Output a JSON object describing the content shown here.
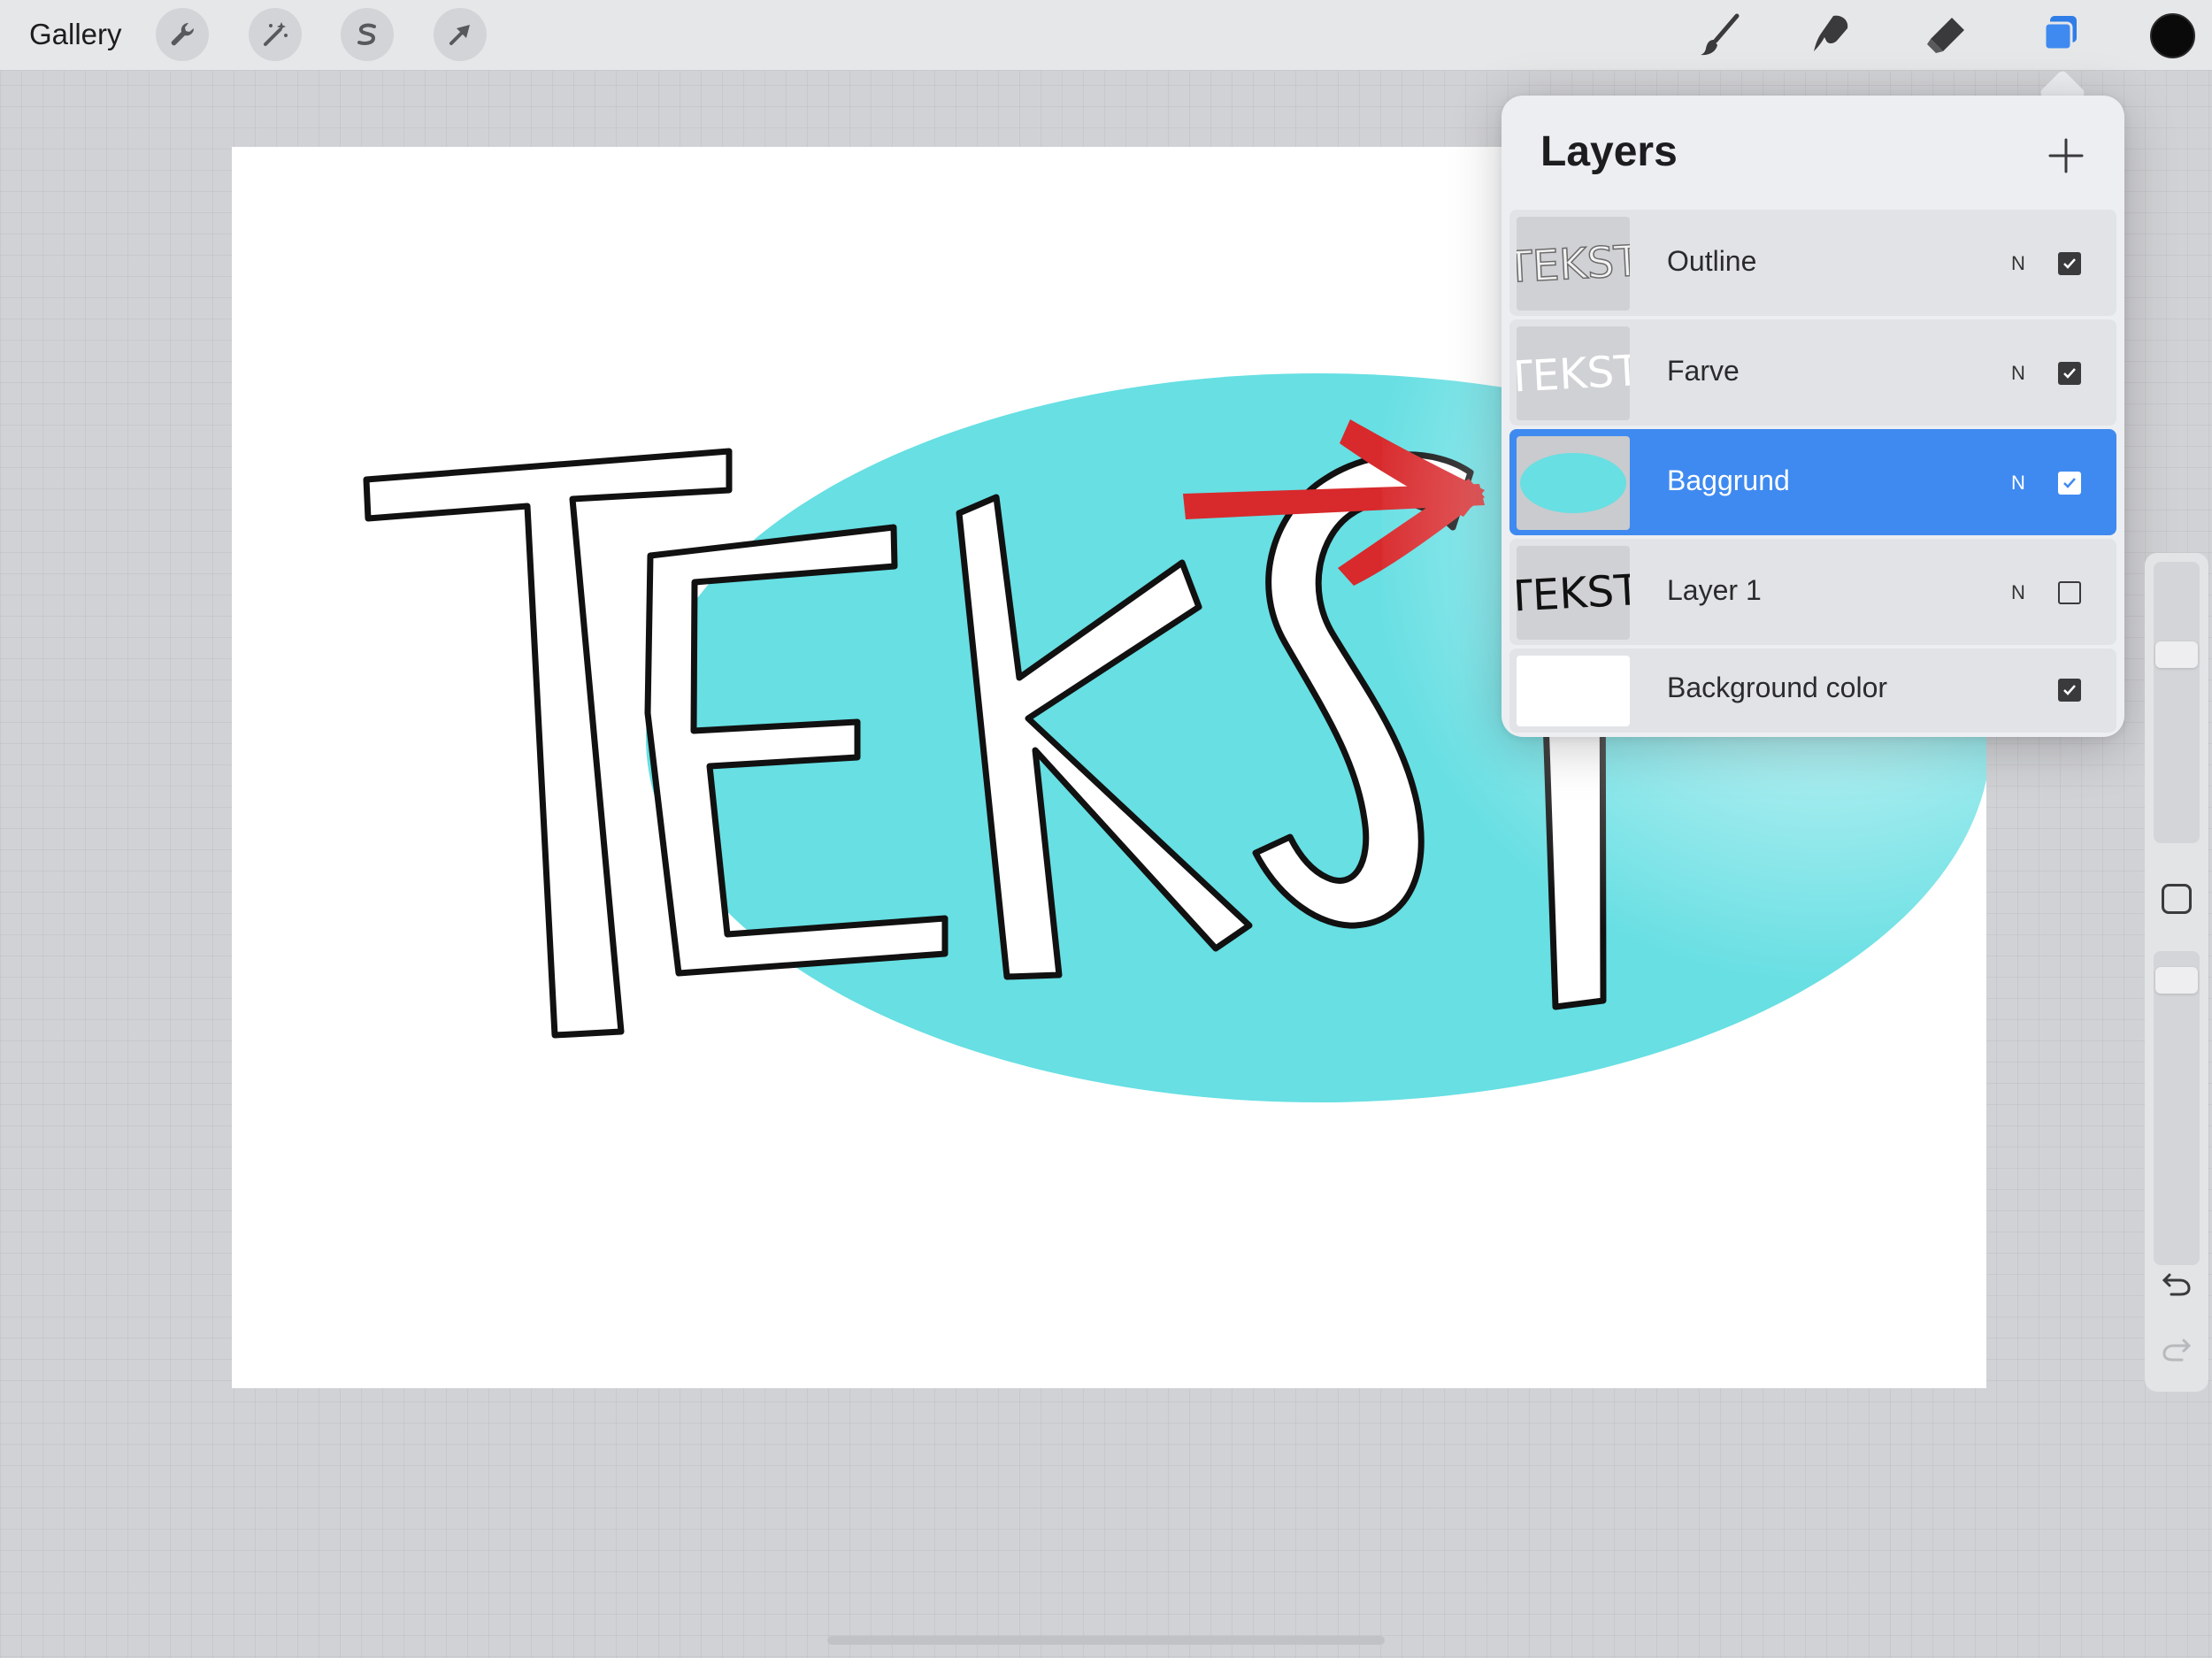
{
  "toolbar": {
    "gallery_label": "Gallery",
    "left_tools": [
      "wrench-icon",
      "magic-wand-icon",
      "selection-s-icon",
      "transform-arrow-icon"
    ],
    "right_tools": [
      "brush-icon",
      "smudge-icon",
      "eraser-icon",
      "layers-icon"
    ],
    "current_color": "#0a0a0a",
    "accent_color": "#3f8af0"
  },
  "layers_panel": {
    "title": "Layers",
    "add_icon": "plus-icon",
    "layers": [
      {
        "name": "Outline",
        "blend_mode": "N",
        "visible": true,
        "selected": false
      },
      {
        "name": "Farve",
        "blend_mode": "N",
        "visible": true,
        "selected": false
      },
      {
        "name": "Baggrund",
        "blend_mode": "N",
        "visible": true,
        "selected": true
      },
      {
        "name": "Layer 1",
        "blend_mode": "N",
        "visible": false,
        "selected": false
      },
      {
        "name": "Background color",
        "blend_mode": "",
        "visible": true,
        "selected": false
      }
    ],
    "thumbnail_text": "TEKST"
  },
  "canvas": {
    "artwork_text": "TEKST",
    "ellipse_color": "#67dfe3",
    "arrow_color": "#d8292c"
  },
  "sidebar": {
    "icons": [
      "modify-square-icon",
      "undo-icon",
      "redo-icon"
    ]
  }
}
